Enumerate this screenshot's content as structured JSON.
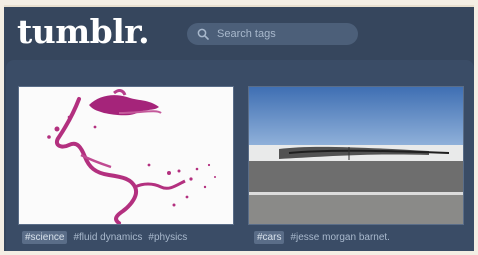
{
  "header": {
    "logo": "tumblr.",
    "search_placeholder": "Search tags"
  },
  "posts": [
    {
      "tags": [
        "#science",
        "#fluid dynamics",
        "#physics"
      ]
    },
    {
      "tags": [
        "#cars",
        "#jesse morgan barnet."
      ]
    }
  ],
  "colors": {
    "background": "#36465d",
    "panel": "#3a4c66",
    "search": "#4c5f79"
  }
}
